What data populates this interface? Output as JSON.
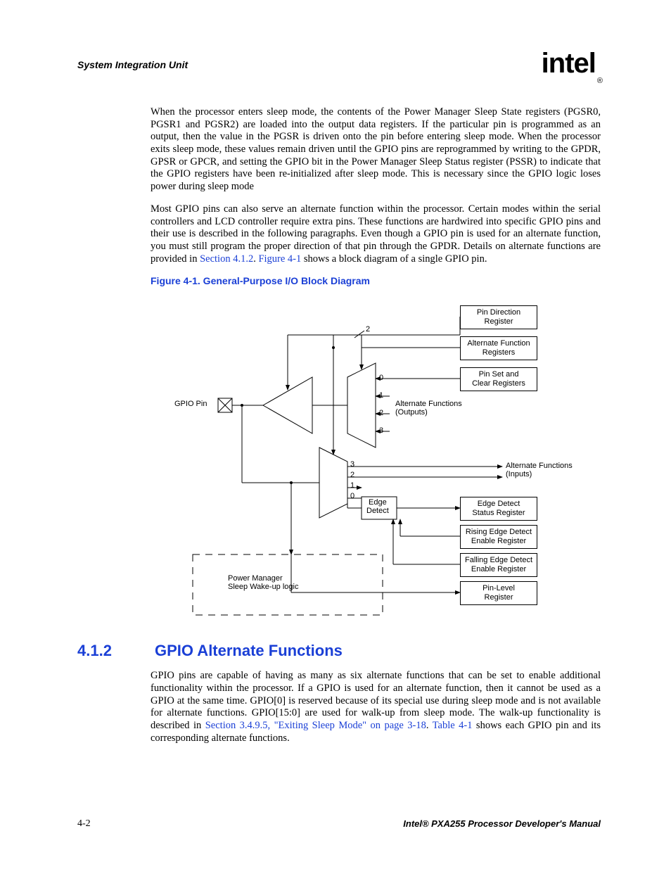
{
  "header": {
    "left": "System Integration Unit",
    "logo_text": "intel",
    "logo_reg": "®"
  },
  "paragraphs": {
    "p1": "When the processor enters sleep mode, the contents of the Power Manager Sleep State registers (PGSR0, PGSR1 and PGSR2) are loaded into the output data registers. If the particular pin is programmed as an output, then the value in the PGSR is driven onto the pin before entering sleep mode. When the processor exits sleep mode, these values remain driven until the GPIO pins are reprogrammed by writing to the GPDR, GPSR or GPCR, and setting the GPIO bit in the Power Manager Sleep Status register (PSSR) to indicate that the GPIO registers have been re-initialized after sleep mode. This is necessary since the GPIO logic loses power during sleep mode",
    "p2a": "Most GPIO pins can also serve an alternate function within the processor. Certain modes within the serial controllers and LCD controller require extra pins. These functions are hardwired into specific GPIO pins and their use is described in the following paragraphs. Even though a GPIO pin is used for an alternate function, you must still program the proper direction of that pin through the GPDR. Details on alternate functions are provided in ",
    "p2_link1": "Section 4.1.2",
    "p2b": ". ",
    "p2_link2": "Figure 4-1",
    "p2c": " shows a block diagram of a single GPIO pin.",
    "p3a": "GPIO pins are capable of having as many as six alternate functions that can be set to enable additional functionality within the processor. If a GPIO is used for an alternate function, then it cannot be used as a GPIO at the same time. GPIO[0] is reserved because of its special use during sleep mode and is not available for alternate functions. GPIO[15:0] are used for walk-up from sleep mode. The walk-up functionality is described in ",
    "p3_link1": "Section 3.4.9.5, \"Exiting Sleep Mode\" on page 3-18",
    "p3b": ". ",
    "p3_link2": "Table 4-1",
    "p3c": " shows each GPIO pin and its corresponding alternate functions."
  },
  "figure": {
    "caption": "Figure 4-1. General-Purpose I/O Block Diagram",
    "gpio_pin": "GPIO Pin",
    "two": "2",
    "mux_out": [
      "0",
      "1",
      "2",
      "3"
    ],
    "mux_in": [
      "3",
      "2",
      "1",
      "0"
    ],
    "alt_out": "Alternate Functions\n(Outputs)",
    "alt_in": "Alternate Functions\n(Inputs)",
    "edge_detect": "Edge\nDetect",
    "power_mgr": "Power Manager\nSleep Wake-up logic",
    "reg_pin_dir": "Pin Direction\nRegister",
    "reg_alt_fn": "Alternate Function\nRegisters",
    "reg_pin_set": "Pin Set and\nClear Registers",
    "reg_edge_status": "Edge Detect\nStatus Register",
    "reg_rising": "Rising Edge Detect\nEnable Register",
    "reg_falling": "Falling Edge Detect\nEnable Register",
    "reg_pin_level": "Pin-Level\nRegister"
  },
  "section": {
    "num": "4.1.2",
    "title": "GPIO Alternate Functions"
  },
  "footer": {
    "page": "4-2",
    "manual": "Intel® PXA255 Processor Developer's Manual"
  }
}
